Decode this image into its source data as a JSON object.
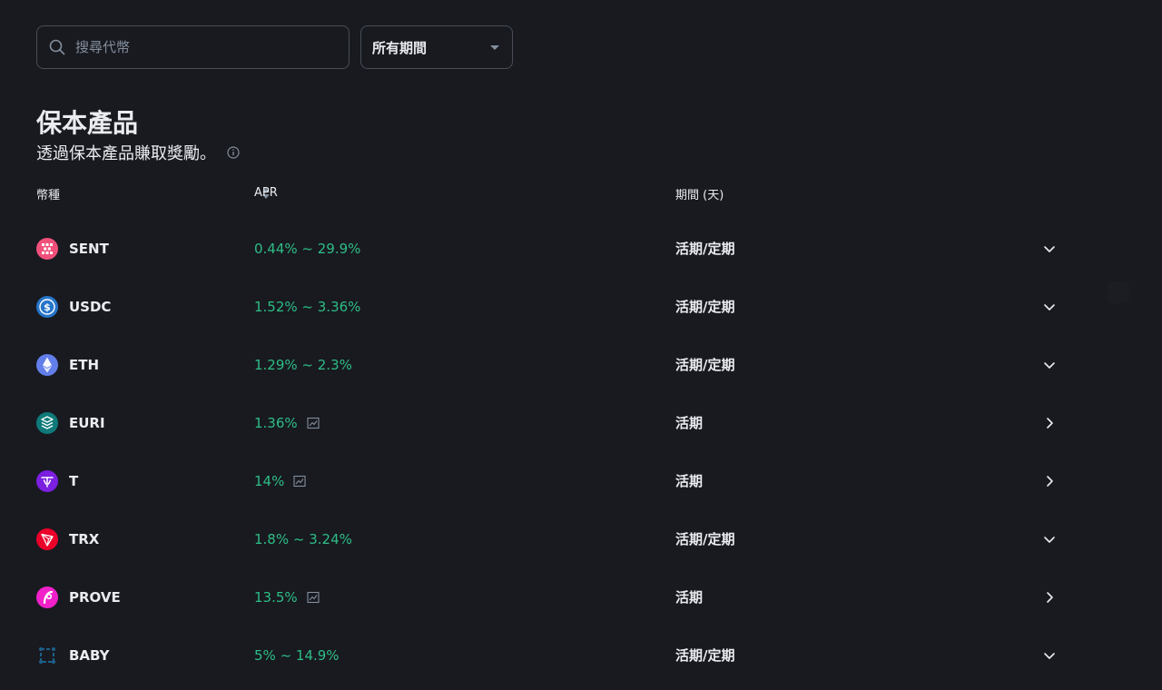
{
  "search": {
    "placeholder": "搜尋代幣"
  },
  "filter": {
    "selected": "所有期間"
  },
  "section": {
    "title": "保本產品",
    "subtitle": "透過保本產品賺取獎勵。"
  },
  "table": {
    "headers": {
      "coin": "幣種",
      "apr": "APR",
      "period": "期間 (天)"
    },
    "rows": [
      {
        "coin": "SENT",
        "apr": "0.44% ~ 29.9%",
        "period": "活期/定期",
        "chart": false,
        "action": "expand"
      },
      {
        "coin": "USDC",
        "apr": "1.52% ~ 3.36%",
        "period": "活期/定期",
        "chart": false,
        "action": "expand"
      },
      {
        "coin": "ETH",
        "apr": "1.29% ~ 2.3%",
        "period": "活期/定期",
        "chart": false,
        "action": "expand"
      },
      {
        "coin": "EURI",
        "apr": "1.36%",
        "period": "活期",
        "chart": true,
        "action": "open"
      },
      {
        "coin": "T",
        "apr": "14%",
        "period": "活期",
        "chart": true,
        "action": "open"
      },
      {
        "coin": "TRX",
        "apr": "1.8% ~ 3.24%",
        "period": "活期/定期",
        "chart": false,
        "action": "expand"
      },
      {
        "coin": "PROVE",
        "apr": "13.5%",
        "period": "活期",
        "chart": true,
        "action": "open"
      },
      {
        "coin": "BABY",
        "apr": "5% ~ 14.9%",
        "period": "活期/定期",
        "chart": false,
        "action": "expand"
      }
    ]
  },
  "colors": {
    "background": "#181a20",
    "apr_green": "#2ebd85",
    "border": "#474d57",
    "muted": "#848e9c"
  },
  "icons": {
    "search": "search-icon",
    "dropdown": "caret-down-icon",
    "info": "info-icon",
    "sort": "sort-icon",
    "expand": "chevron-down-icon",
    "open": "chevron-right-icon",
    "chart": "chart-icon"
  }
}
